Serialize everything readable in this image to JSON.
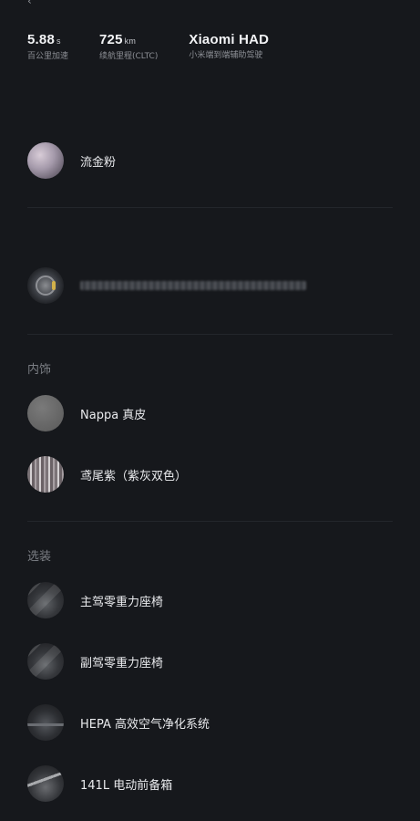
{
  "header": {
    "back_glyph": "‹",
    "title": ""
  },
  "specs": [
    {
      "value": "5.88",
      "unit": "s",
      "label": "百公里加速"
    },
    {
      "value": "725",
      "unit": "km",
      "label": "续航里程(CLTC)"
    },
    {
      "value": "Xiaomi HAD",
      "unit": "",
      "label": "小米端到端辅助驾驶"
    }
  ],
  "sections": {
    "paint": {
      "label": ""
    },
    "wheels": {
      "label": ""
    },
    "interior": {
      "label": "内饰"
    },
    "options": {
      "label": "选装"
    }
  },
  "paint": {
    "name": "流金粉"
  },
  "wheels": {
    "icon": "steering-wheel-icon"
  },
  "interior": {
    "material": "Nappa 真皮",
    "color": "鸢尾紫（紫灰双色）"
  },
  "options": {
    "items": [
      {
        "label": "主驾零重力座椅",
        "icon": "seat-icon"
      },
      {
        "label": "副驾零重力座椅",
        "icon": "seat-icon"
      },
      {
        "label": "HEPA 高效空气净化系统",
        "icon": "air-filter-icon"
      },
      {
        "label": "141L 电动前备箱",
        "icon": "front-trunk-icon"
      }
    ]
  },
  "colors": {
    "background": "#16181c",
    "text_primary": "#e9eaed",
    "text_secondary": "#8d9096",
    "divider": "#23262b"
  }
}
